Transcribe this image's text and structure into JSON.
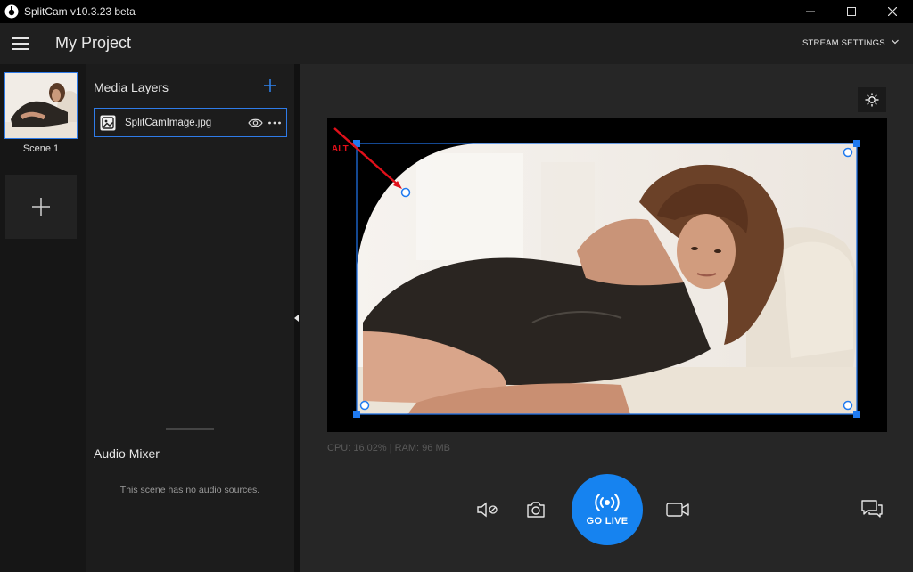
{
  "titlebar": {
    "title": "SplitCam v10.3.23 beta"
  },
  "header": {
    "project_title": "My Project",
    "stream_settings_label": "STREAM SETTINGS"
  },
  "scenes": {
    "items": [
      {
        "label": "Scene 1"
      }
    ]
  },
  "media_layers": {
    "title": "Media Layers",
    "items": [
      {
        "name": "SplitCamImage.jpg"
      }
    ]
  },
  "audio_mixer": {
    "title": "Audio Mixer",
    "empty_text": "This scene has no audio sources."
  },
  "preview": {
    "alt_label": "ALT"
  },
  "stats": {
    "text": "CPU: 16.02% | RAM: 96 MB"
  },
  "controls": {
    "go_live_label": "GO LIVE"
  },
  "colors": {
    "accent": "#1683f0",
    "selection": "#2f7be8",
    "alt_arrow": "#e0101a"
  },
  "icons": [
    "app-logo-icon",
    "minimize-icon",
    "maximize-icon",
    "close-icon",
    "menu-icon",
    "chevron-down-icon",
    "add-icon",
    "image-layer-icon",
    "eye-icon",
    "more-icon",
    "brightness-icon",
    "mute-mic-icon",
    "camera-snapshot-icon",
    "broadcast-icon",
    "video-record-icon",
    "chat-icon"
  ]
}
